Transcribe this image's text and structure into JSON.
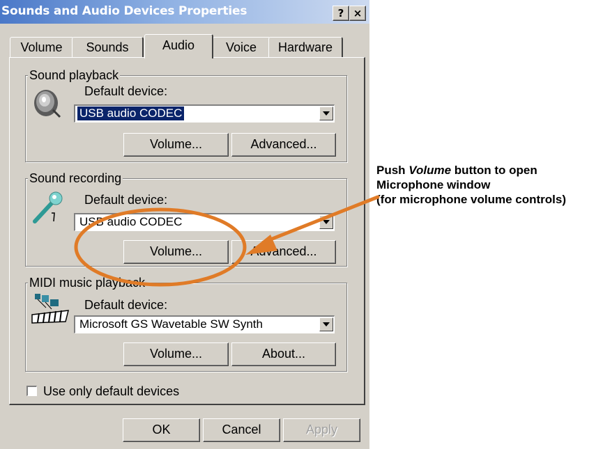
{
  "window": {
    "title": "Sounds and Audio Devices Properties",
    "help_label": "?",
    "close_label": "×"
  },
  "tabs": [
    {
      "label": "Volume",
      "active": false
    },
    {
      "label": "Sounds",
      "active": false
    },
    {
      "label": "Audio",
      "active": true
    },
    {
      "label": "Voice",
      "active": false
    },
    {
      "label": "Hardware",
      "active": false
    }
  ],
  "playback": {
    "legend": "Sound playback",
    "default_label": "Default device:",
    "device": "USB audio CODEC",
    "volume_button": "Volume...",
    "advanced_button": "Advanced..."
  },
  "recording": {
    "legend": "Sound recording",
    "default_label": "Default device:",
    "device": "USB audio CODEC",
    "volume_button": "Volume...",
    "advanced_button": "Advanced..."
  },
  "midi": {
    "legend": "MIDI music playback",
    "default_label": "Default device:",
    "device": "Microsoft GS Wavetable SW Synth",
    "volume_button": "Volume...",
    "about_button": "About..."
  },
  "use_default_devices": {
    "label": "Use only default devices",
    "checked": false
  },
  "footer": {
    "ok_button": "OK",
    "cancel_button": "Cancel",
    "apply_button": "Apply"
  },
  "annotation": {
    "line1_prefix": "Push ",
    "line1_emphasis": "Volume",
    "line1_suffix": " button to open",
    "line2": "Microphone window",
    "line3": "(for microphone volume controls)",
    "highlight_color": "#e07b27"
  },
  "icons": {
    "playback": "speaker-icon",
    "recording": "microphone-icon",
    "midi": "midi-keyboard-icon"
  }
}
